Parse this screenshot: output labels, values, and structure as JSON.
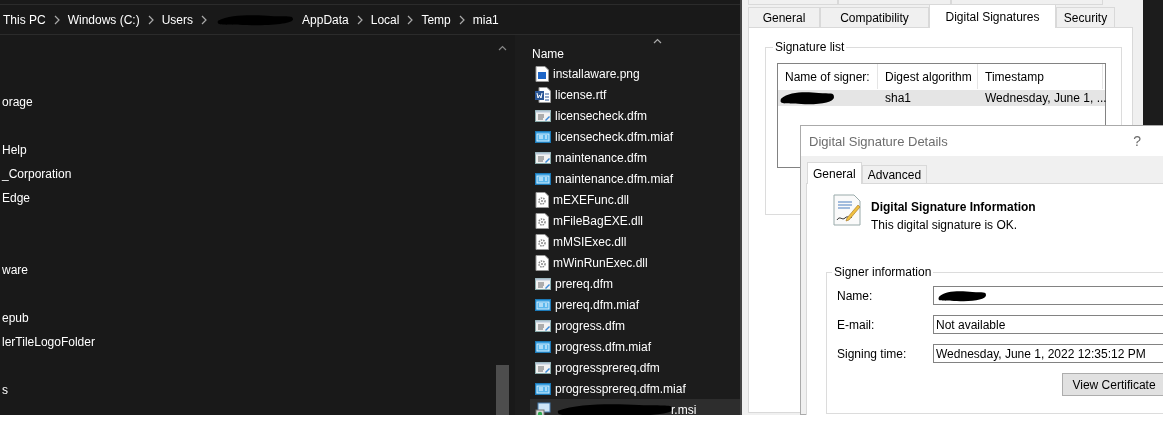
{
  "explorer": {
    "breadcrumb": [
      {
        "label": "This PC",
        "redacted_before": false
      },
      {
        "label": "Windows (C:)",
        "redacted_before": false
      },
      {
        "label": "Users",
        "redacted_before": false
      },
      {
        "label": "AppData",
        "redacted_before": true
      },
      {
        "label": "Local",
        "redacted_before": false
      },
      {
        "label": "Temp",
        "redacted_before": false
      },
      {
        "label": "mia1",
        "redacted_before": false
      }
    ],
    "nav_items": [
      "orage",
      "Help",
      "_Corporation",
      "Edge",
      "ware",
      "epub",
      "lerTileLogoFolder",
      "s"
    ],
    "column_header": "Name",
    "files": [
      {
        "name": "installaware.png",
        "kind": "image",
        "redacted": false,
        "selected": false
      },
      {
        "name": "license.rtf",
        "kind": "word",
        "redacted": false,
        "selected": false
      },
      {
        "name": "licensecheck.dfm",
        "kind": "dfm",
        "redacted": false,
        "selected": false
      },
      {
        "name": "licensecheck.dfm.miaf",
        "kind": "miaf",
        "redacted": false,
        "selected": false
      },
      {
        "name": "maintenance.dfm",
        "kind": "dfm",
        "redacted": false,
        "selected": false
      },
      {
        "name": "maintenance.dfm.miaf",
        "kind": "miaf",
        "redacted": false,
        "selected": false
      },
      {
        "name": "mEXEFunc.dll",
        "kind": "dll",
        "redacted": false,
        "selected": false
      },
      {
        "name": "mFileBagEXE.dll",
        "kind": "dll",
        "redacted": false,
        "selected": false
      },
      {
        "name": "mMSIExec.dll",
        "kind": "dll",
        "redacted": false,
        "selected": false
      },
      {
        "name": "mWinRunExec.dll",
        "kind": "dll",
        "redacted": false,
        "selected": false
      },
      {
        "name": "prereq.dfm",
        "kind": "dfm",
        "redacted": false,
        "selected": false
      },
      {
        "name": "prereq.dfm.miaf",
        "kind": "miaf",
        "redacted": false,
        "selected": false
      },
      {
        "name": "progress.dfm",
        "kind": "dfm",
        "redacted": false,
        "selected": false
      },
      {
        "name": "progress.dfm.miaf",
        "kind": "miaf",
        "redacted": false,
        "selected": false
      },
      {
        "name": "progressprereq.dfm",
        "kind": "dfm",
        "redacted": false,
        "selected": false
      },
      {
        "name": "progressprereq.dfm.miaf",
        "kind": "miaf",
        "redacted": false,
        "selected": false
      },
      {
        "name": "r.msi",
        "kind": "msi",
        "redacted": true,
        "selected": true
      }
    ]
  },
  "properties": {
    "tabs": [
      {
        "label": "General",
        "selected": false
      },
      {
        "label": "Compatibility",
        "selected": false
      },
      {
        "label": "Digital Signatures",
        "selected": true
      },
      {
        "label": "Security",
        "selected": false
      }
    ],
    "signature_list": {
      "title": "Signature list",
      "columns": [
        "Name of signer:",
        "Digest algorithm",
        "Timestamp"
      ],
      "rows": [
        {
          "name_redacted": true,
          "digest": "sha1",
          "timestamp": "Wednesday, June 1, ...",
          "selected": true
        }
      ]
    }
  },
  "details": {
    "title": "Digital Signature Details",
    "help": "?",
    "tabs": [
      {
        "label": "General",
        "selected": true
      },
      {
        "label": "Advanced",
        "selected": false
      }
    ],
    "info_heading": "Digital Signature Information",
    "info_text": "This digital signature is OK.",
    "signer_group": "Signer information",
    "fields": [
      {
        "label": "Name:",
        "redacted": true
      },
      {
        "label": "E-mail:",
        "value": "Not available",
        "redacted": false
      },
      {
        "label": "Signing time:",
        "value": "Wednesday, June 1, 2022 12:35:12 PM",
        "redacted": false
      }
    ],
    "button": "View Certificate"
  }
}
